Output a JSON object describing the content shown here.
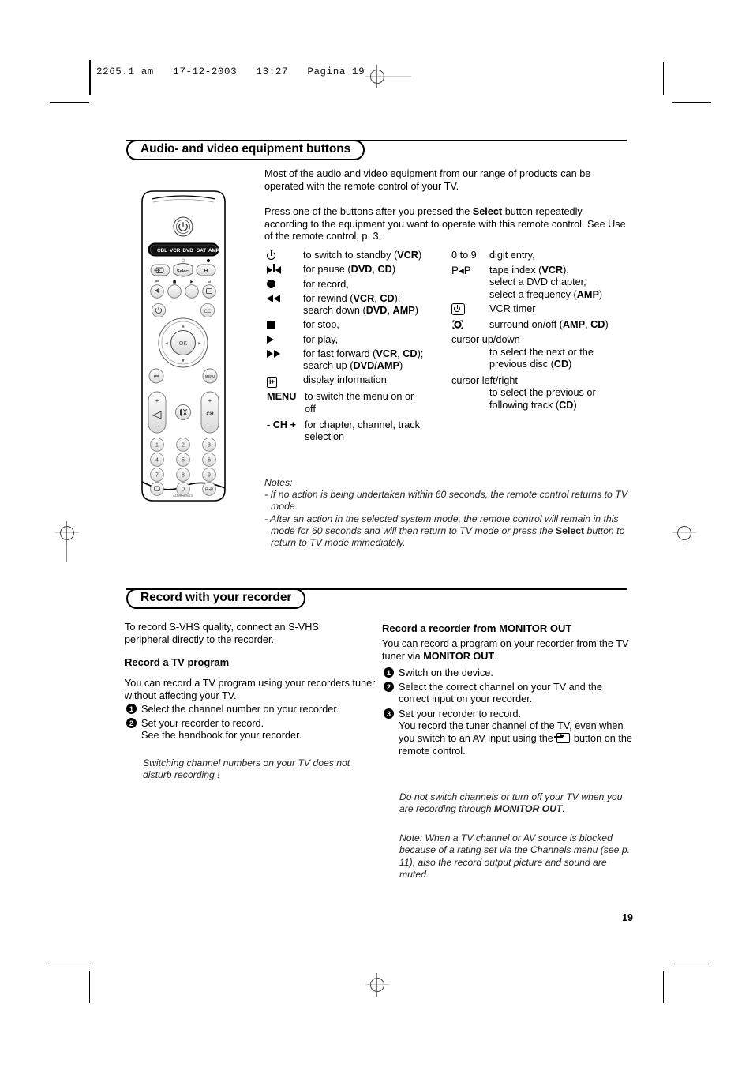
{
  "print_header": {
    "text": "2265.1 am   17-12-2003   13:27   Pagina 19"
  },
  "page_number": "19",
  "section1": {
    "title": "Audio- and video equipment buttons",
    "intro1": "Most of the audio and video equipment from our range of products can be operated with the remote control of your TV.",
    "intro2_a": "Press one of the buttons after you pressed the ",
    "intro2_bold": "Select",
    "intro2_b": " button repeatedly according to the equipment you want to operate with this remote control. See Use of the remote control, p. 3.",
    "buttons_left": [
      {
        "icon": "power-icon",
        "desc_html": "to switch to standby (<b>VCR</b>)"
      },
      {
        "icon": "pause-icon",
        "desc_html": "for pause (<b>DVD</b>, <b>CD</b>)"
      },
      {
        "icon": "record-icon",
        "desc_html": "for record,"
      },
      {
        "icon": "rewind-icon",
        "desc_html": "for rewind (<b>VCR</b>, <b>CD</b>);<br>search down (<b>DVD</b>, <b>AMP</b>)"
      },
      {
        "icon": "stop-icon",
        "desc_html": "for stop,"
      },
      {
        "icon": "play-icon",
        "desc_html": "for play,"
      },
      {
        "icon": "fast-forward-icon",
        "desc_html": "for fast forward (<b>VCR</b>, <b>CD</b>);<br>search up (<b>DVD/AMP</b>)"
      },
      {
        "icon": "info-icon",
        "desc_html": "display information"
      },
      {
        "icon": "menu-label",
        "label": "MENU",
        "desc_html": "to switch the menu on or<br>off"
      },
      {
        "icon": "ch-label",
        "label": "- CH +",
        "desc_html": "for chapter, channel, track<br>selection"
      }
    ],
    "buttons_right": [
      {
        "icon": "digits-label",
        "label": "0 to 9",
        "desc_html": "digit entry,"
      },
      {
        "icon": "pip-label",
        "label": "P◂P",
        "desc_html": "tape index (<b>VCR</b>),<br>select a DVD chapter,<br>select a frequency (<b>AMP</b>)"
      },
      {
        "icon": "vcr-timer-icon",
        "desc_html": "VCR timer"
      },
      {
        "icon": "surround-icon",
        "desc_html": "surround on/off (<b>AMP</b>, <b>CD</b>)"
      }
    ],
    "cursor_updown_label": "cursor up/down",
    "cursor_updown_desc_html": "to select the next or the<br>previous disc (<b>CD</b>)",
    "cursor_leftright_label": "cursor left/right",
    "cursor_leftright_desc_html": "to select the previous or<br>following track (<b>CD</b>)",
    "notes_title": "Notes:",
    "note1": "- If no action is being undertaken within 60 seconds, the remote control returns to TV mode.",
    "note2_a": "- After an action in the selected system mode, the remote control will remain in this mode for 60 seconds and will then return to TV mode or press the ",
    "note2_bold": "Select",
    "note2_b": " button to return to TV mode immediately."
  },
  "section2": {
    "title": "Record with your recorder",
    "left": {
      "intro": "To record S-VHS quality, connect an S-VHS peripheral directly to the recorder.",
      "subheading": "Record a TV program",
      "para": "You can record a TV program using your recorders tuner without affecting your TV.",
      "steps": [
        {
          "num": "1",
          "text": "Select the channel number on your recorder."
        },
        {
          "num": "2",
          "text": "Set your recorder to record.\nSee the handbook for your recorder."
        }
      ],
      "italic_note": "Switching channel numbers on your TV does not disturb recording !"
    },
    "right": {
      "subheading_a": "Record a recorder from ",
      "subheading_b": "MONITOR OUT",
      "para_a": "You can record a program on your recorder from the TV tuner via ",
      "para_bold": "MONITOR OUT",
      "para_b": ".",
      "steps": [
        {
          "num": "1",
          "text_html": "Switch on the device."
        },
        {
          "num": "2",
          "text_html": "Select the correct channel on your TV and the correct input on your recorder."
        },
        {
          "num": "3",
          "text_html": "Set your recorder to record.<br>You record the tuner channel of the TV, even when you switch to an AV input using the <span class=\"g-av\" data-name=\"av-input-icon\"><span class=\"arrow\"></span><span class=\"head\"></span></span> button on the remote control."
        }
      ],
      "italic_note1_a": "Do not switch channels or turn off your TV when you are recording through ",
      "italic_note1_bold": "MONITOR OUT",
      "italic_note1_b": ".",
      "italic_note2": "Note: When a TV channel or AV source is blocked because of a rating set via the Channels menu (see p. 11), also the record output picture and sound are muted."
    }
  },
  "remote": {
    "mode_labels": [
      "CBL",
      "VCR",
      "DVD",
      "SAT",
      "AMP"
    ],
    "select_label": "Select",
    "ok_label": "OK",
    "menu_label": "MENU",
    "ch_label": "CH",
    "plus": "+",
    "minus": "–",
    "pip_label": "P◂P",
    "cc_label": "CC",
    "brand_text": "Active Control",
    "keypad": [
      "1",
      "2",
      "3",
      "4",
      "5",
      "6",
      "7",
      "8",
      "9",
      "0"
    ]
  }
}
